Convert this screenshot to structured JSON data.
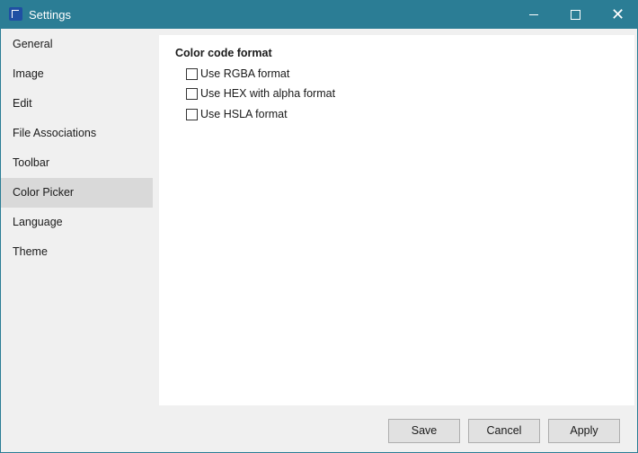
{
  "window": {
    "title": "Settings"
  },
  "sidebar": {
    "items": [
      {
        "label": "General"
      },
      {
        "label": "Image"
      },
      {
        "label": "Edit"
      },
      {
        "label": "File Associations"
      },
      {
        "label": "Toolbar"
      },
      {
        "label": "Color Picker",
        "selected": true
      },
      {
        "label": "Language"
      },
      {
        "label": "Theme"
      }
    ]
  },
  "panel": {
    "section_title": "Color code format",
    "options": [
      {
        "label": "Use RGBA format",
        "checked": false
      },
      {
        "label": "Use HEX with alpha format",
        "checked": false
      },
      {
        "label": "Use HSLA format",
        "checked": false
      }
    ]
  },
  "footer": {
    "save": "Save",
    "cancel": "Cancel",
    "apply": "Apply"
  },
  "colors": {
    "titlebar": "#2b7d95",
    "selected_item": "#d9d9d9"
  }
}
